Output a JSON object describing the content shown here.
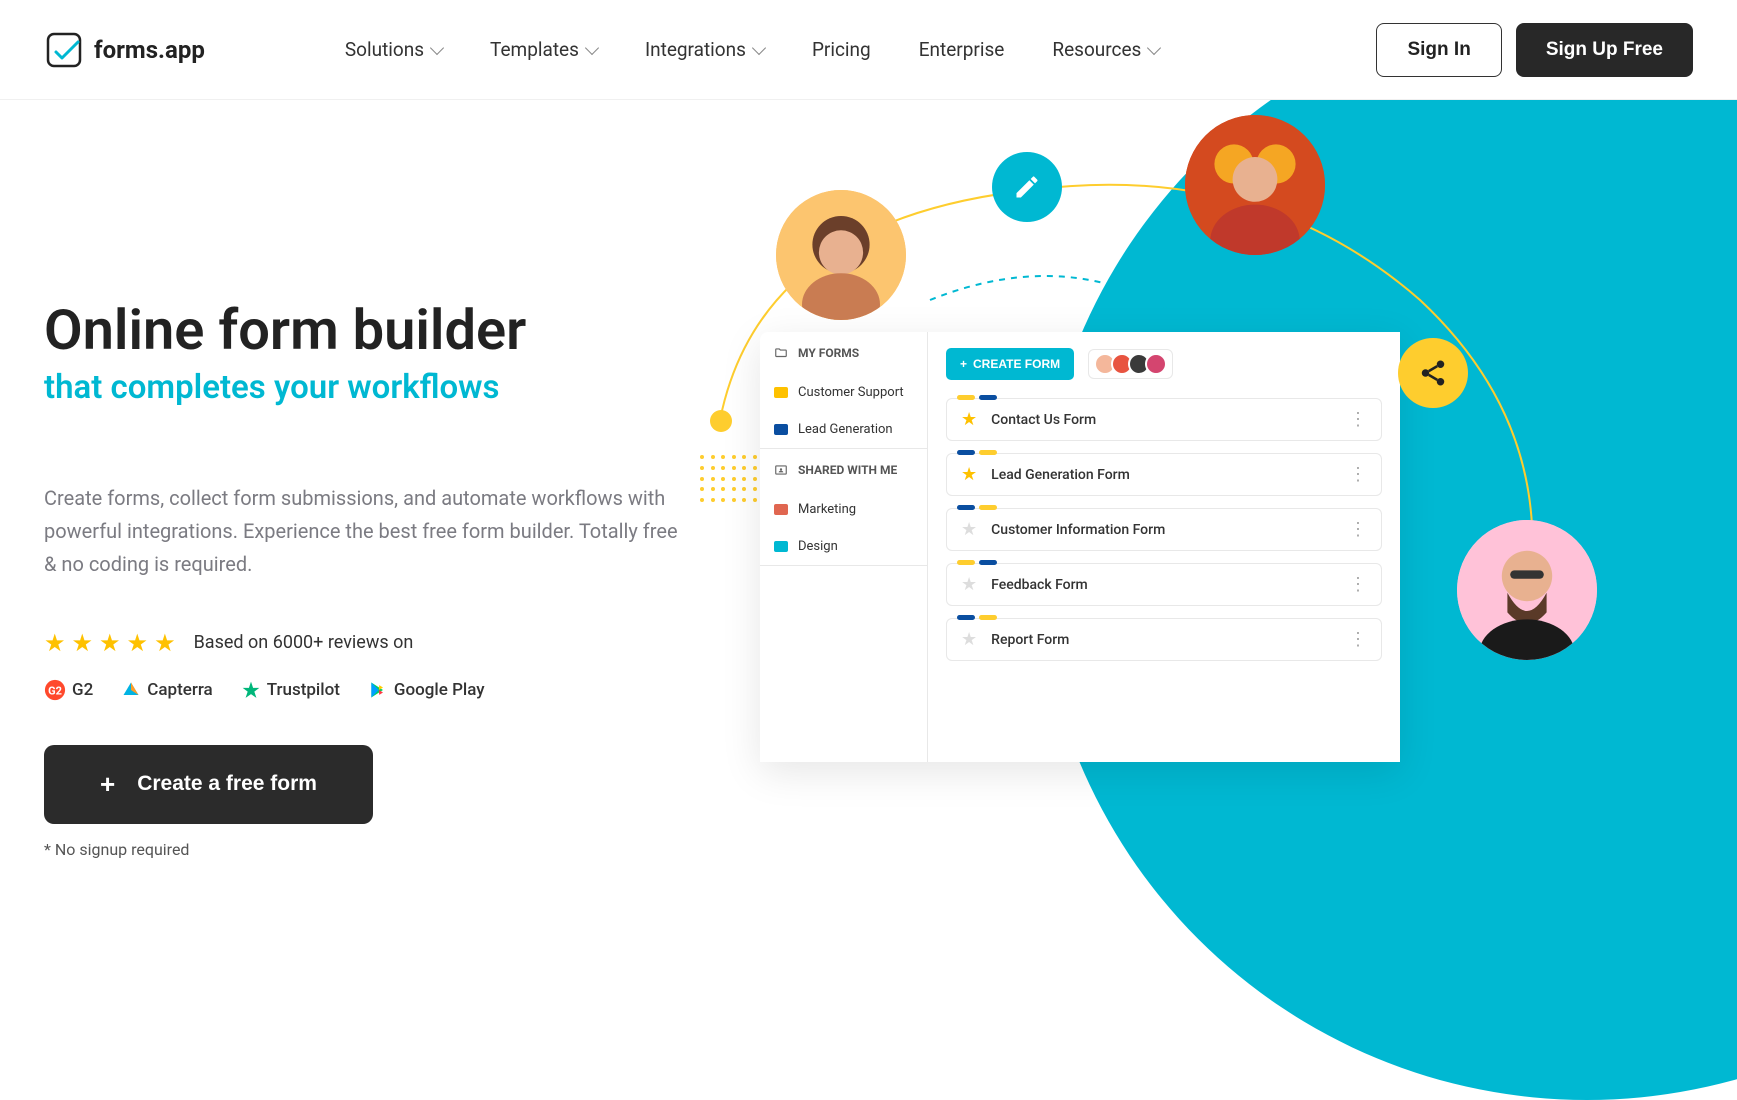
{
  "brand": "forms.app",
  "nav": {
    "items": [
      {
        "label": "Solutions",
        "dropdown": true
      },
      {
        "label": "Templates",
        "dropdown": true
      },
      {
        "label": "Integrations",
        "dropdown": true
      },
      {
        "label": "Pricing",
        "dropdown": false
      },
      {
        "label": "Enterprise",
        "dropdown": false
      },
      {
        "label": "Resources",
        "dropdown": true
      }
    ],
    "signin": "Sign In",
    "signup": "Sign Up Free"
  },
  "hero": {
    "title": "Online form builder",
    "subtitle": "that completes your workflows",
    "description": "Create forms, collect form submissions, and automate workflows with powerful integrations. Experience the best free form builder. Totally free & no coding is required.",
    "rating_text": "Based on 6000+ reviews on",
    "platforms": [
      "G2",
      "Capterra",
      "Trustpilot",
      "Google Play"
    ],
    "cta": "Create a free form",
    "note": "* No signup required"
  },
  "mockup": {
    "my_forms_label": "MY FORMS",
    "shared_label": "SHARED WITH ME",
    "my_folders": [
      {
        "name": "Customer Support",
        "color": "#fec100"
      },
      {
        "name": "Lead Generation",
        "color": "#0a4ea0"
      }
    ],
    "shared_folders": [
      {
        "name": "Marketing",
        "color": "#e06650"
      },
      {
        "name": "Design",
        "color": "#00b8d2"
      }
    ],
    "create_label": "CREATE FORM",
    "collab_colors": [
      "#f4b79b",
      "#e85440",
      "#3a3a3a",
      "#d4456f"
    ],
    "forms": [
      {
        "name": "Contact Us Form",
        "starred": true,
        "bar1": "#fecd2e",
        "bar2": "#0a4ea0"
      },
      {
        "name": "Lead Generation Form",
        "starred": true,
        "bar1": "#0a4ea0",
        "bar2": "#fecd2e"
      },
      {
        "name": "Customer Information Form",
        "starred": false,
        "bar1": "#0a4ea0",
        "bar2": "#fecd2e"
      },
      {
        "name": "Feedback Form",
        "starred": false,
        "bar1": "#fecd2e",
        "bar2": "#0a4ea0"
      },
      {
        "name": "Report Form",
        "starred": false,
        "bar1": "#0a4ea0",
        "bar2": "#fecd2e"
      }
    ]
  }
}
